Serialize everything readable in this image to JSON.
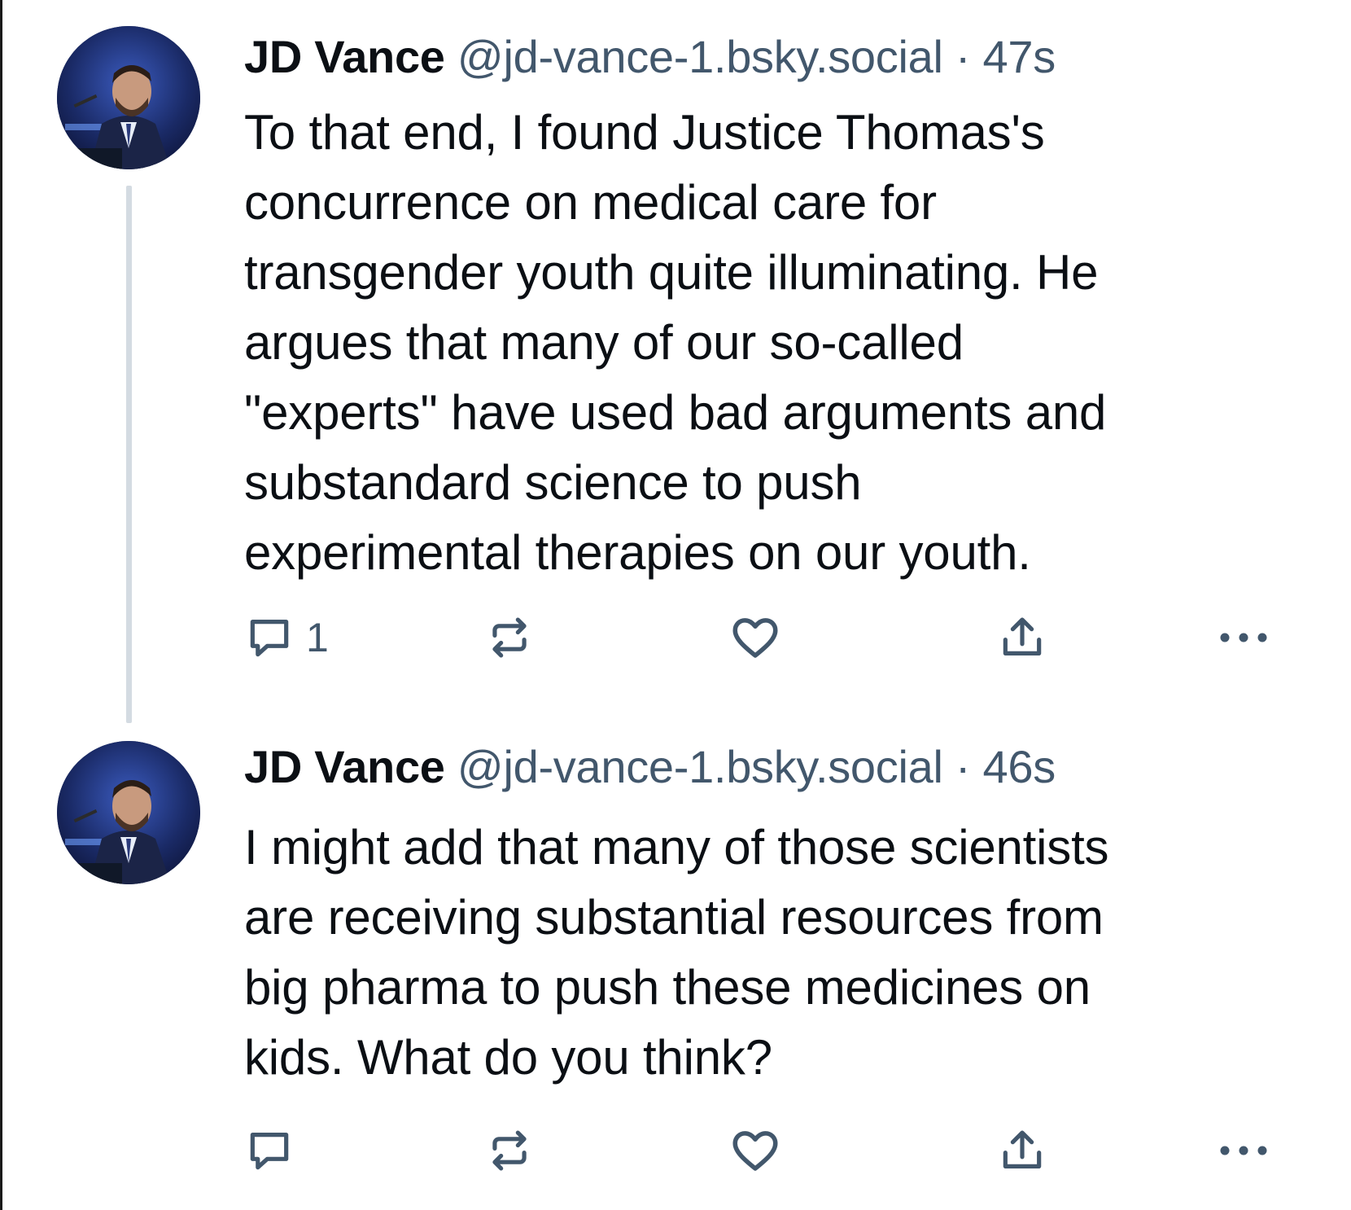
{
  "colors": {
    "text": "#0b0f14",
    "muted": "#42576c",
    "thread_line": "#d4dbe2",
    "icon": "#42576c"
  },
  "posts": [
    {
      "author": "JD Vance",
      "handle": "@jd-vance-1.bsky.social",
      "separator": "·",
      "time": "47s",
      "lines": [
        "To that end, I found Justice Thomas's",
        "concurrence on medical care for",
        "transgender youth quite illuminating. He",
        "argues that many of our so-called",
        "\"experts\" have used bad arguments and",
        "substandard science to push",
        "experimental therapies on our youth."
      ],
      "reply_count": "1",
      "icons": [
        "reply-icon",
        "repost-icon",
        "like-icon",
        "share-icon",
        "more-icon"
      ]
    },
    {
      "author": "JD Vance",
      "handle": "@jd-vance-1.bsky.social",
      "separator": "·",
      "time": "46s",
      "lines": [
        "I might add that many of those scientists",
        "are receiving substantial resources from",
        "big pharma to push these medicines on",
        "kids. What do you think?"
      ],
      "reply_count": "",
      "icons": [
        "reply-icon",
        "repost-icon",
        "like-icon",
        "share-icon",
        "more-icon"
      ]
    }
  ]
}
